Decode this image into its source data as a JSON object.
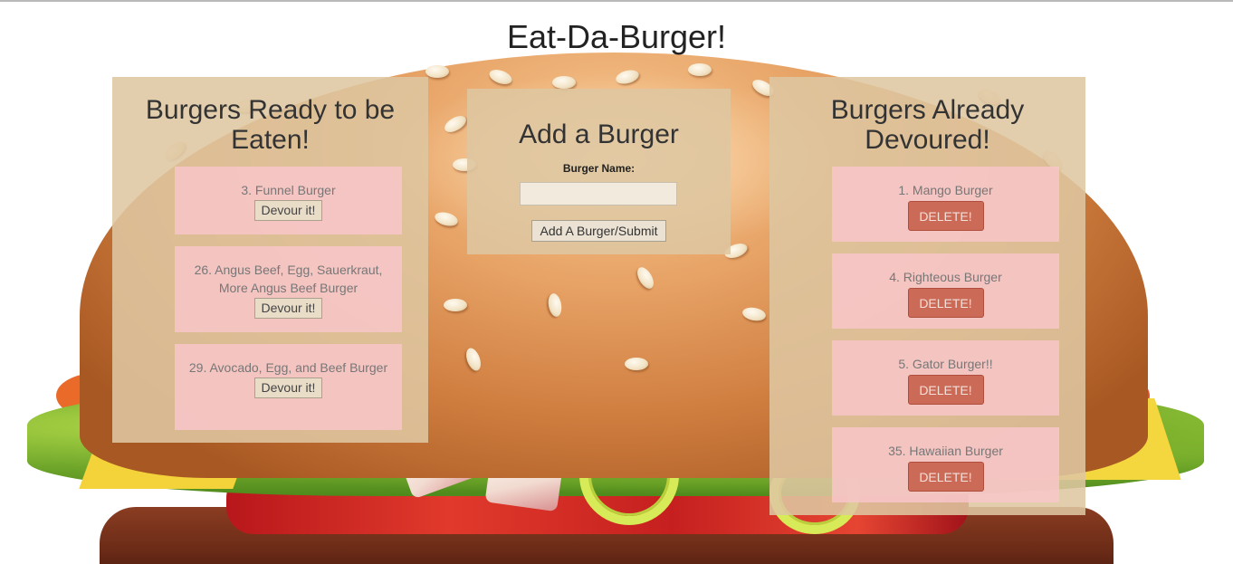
{
  "page": {
    "title": "Eat-Da-Burger!"
  },
  "ready_panel": {
    "heading": "Burgers Ready to be Eaten!",
    "items": [
      {
        "name": "3. Funnel Burger",
        "button": "Devour it!"
      },
      {
        "name": "26. Angus Beef, Egg, Sauerkraut, More Angus Beef Burger",
        "button": "Devour it!"
      },
      {
        "name": "29. Avocado, Egg, and Beef Burger",
        "button": "Devour it!"
      }
    ]
  },
  "add_panel": {
    "heading": "Add a Burger",
    "label": "Burger Name:",
    "input_value": "",
    "submit": "Add A Burger/Submit"
  },
  "devoured_panel": {
    "heading": "Burgers Already Devoured!",
    "items": [
      {
        "name": "1. Mango Burger",
        "button": "DELETE!"
      },
      {
        "name": "4. Righteous Burger",
        "button": "DELETE!"
      },
      {
        "name": "5. Gator Burger!!",
        "button": "DELETE!"
      },
      {
        "name": "35. Hawaiian Burger",
        "button": "DELETE!"
      }
    ]
  },
  "colors": {
    "panel_bg": "#dec6a0",
    "card_bg": "#f8c5c9",
    "delete_btn": "#cc6a58"
  }
}
